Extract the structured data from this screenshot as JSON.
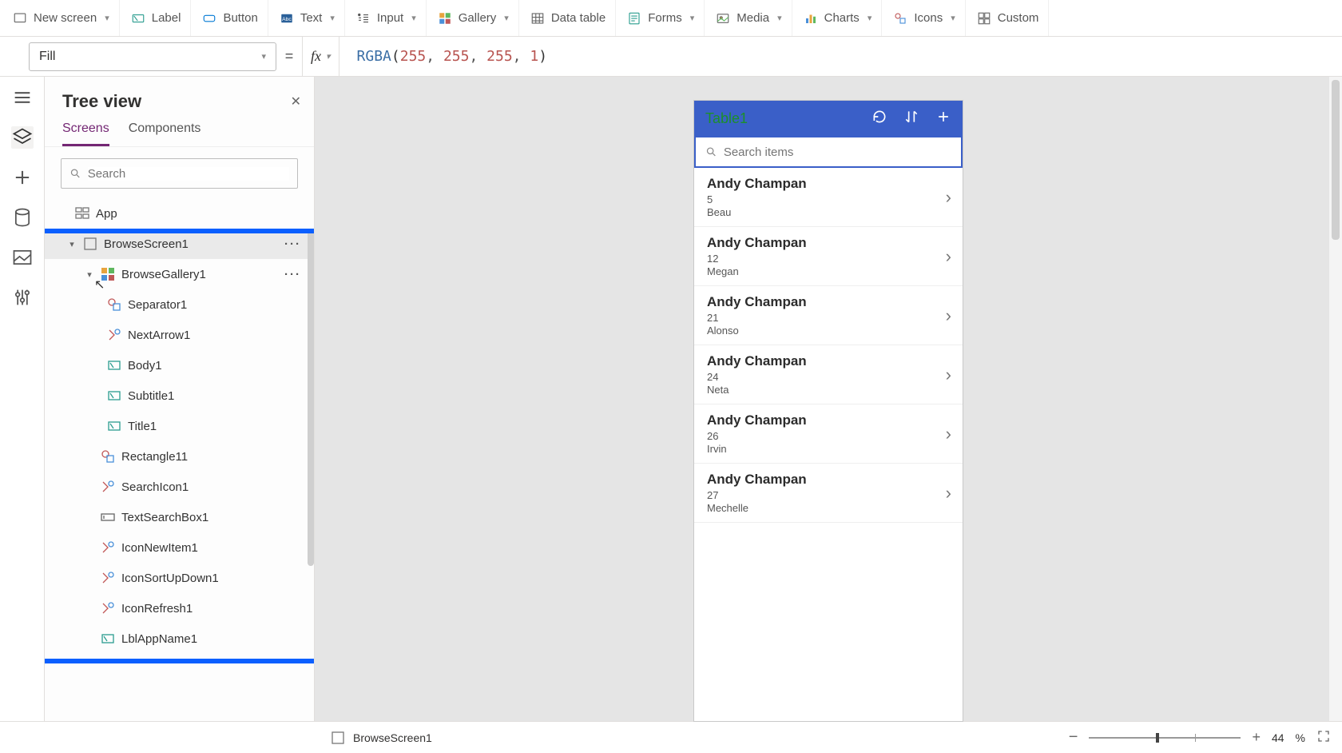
{
  "ribbon": {
    "newScreen": "New screen",
    "label": "Label",
    "button": "Button",
    "text": "Text",
    "input": "Input",
    "gallery": "Gallery",
    "dataTable": "Data table",
    "forms": "Forms",
    "media": "Media",
    "charts": "Charts",
    "icons": "Icons",
    "custom": "Custom"
  },
  "propertyBar": {
    "property": "Fill",
    "formula_fn": "RGBA",
    "formula_args": [
      "255",
      "255",
      "255",
      "1"
    ]
  },
  "treeView": {
    "title": "Tree view",
    "tabs": {
      "screens": "Screens",
      "components": "Components"
    },
    "searchPlaceholder": "Search",
    "nodes": {
      "app": "App",
      "browseScreen1": "BrowseScreen1",
      "browseGallery1": "BrowseGallery1",
      "separator1": "Separator1",
      "nextArrow1": "NextArrow1",
      "body1": "Body1",
      "subtitle1": "Subtitle1",
      "title1": "Title1",
      "rectangle11": "Rectangle11",
      "searchIcon1": "SearchIcon1",
      "textSearchBox1": "TextSearchBox1",
      "iconNewItem1": "IconNewItem1",
      "iconSortUpDown1": "IconSortUpDown1",
      "iconRefresh1": "IconRefresh1",
      "lblAppName1": "LblAppName1"
    }
  },
  "phone": {
    "title": "Table1",
    "searchPlaceholder": "Search items",
    "items": [
      {
        "title": "Andy Champan",
        "sub": "5",
        "body": "Beau"
      },
      {
        "title": "Andy Champan",
        "sub": "12",
        "body": "Megan"
      },
      {
        "title": "Andy Champan",
        "sub": "21",
        "body": "Alonso"
      },
      {
        "title": "Andy Champan",
        "sub": "24",
        "body": "Neta"
      },
      {
        "title": "Andy Champan",
        "sub": "26",
        "body": "Irvin"
      },
      {
        "title": "Andy Champan",
        "sub": "27",
        "body": "Mechelle"
      }
    ]
  },
  "status": {
    "selected": "BrowseScreen1",
    "zoom": "44",
    "pct": "%"
  }
}
